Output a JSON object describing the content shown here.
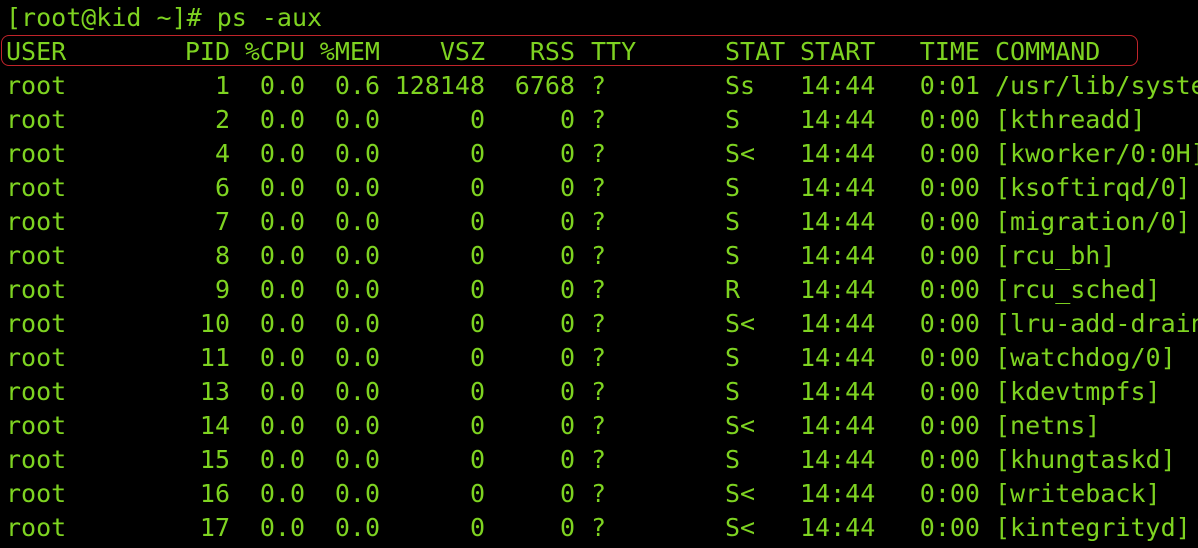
{
  "prompt": "[root@kid ~]# ps -aux",
  "header": {
    "user": "USER",
    "pid": "PID",
    "cpu": "%CPU",
    "mem": "%MEM",
    "vsz": "VSZ",
    "rss": "RSS",
    "tty": "TTY",
    "stat": "STAT",
    "start": "START",
    "time": "TIME",
    "command": "COMMAND"
  },
  "colors": {
    "text": "#7ed321",
    "background": "#000000",
    "highlight_border": "#c0242a"
  },
  "rows": [
    {
      "user": "root",
      "pid": "1",
      "cpu": "0.0",
      "mem": "0.6",
      "vsz": "128148",
      "rss": "6768",
      "tty": "?",
      "stat": "Ss",
      "start": "14:44",
      "time": "0:01",
      "command": "/usr/lib/syste"
    },
    {
      "user": "root",
      "pid": "2",
      "cpu": "0.0",
      "mem": "0.0",
      "vsz": "0",
      "rss": "0",
      "tty": "?",
      "stat": "S",
      "start": "14:44",
      "time": "0:00",
      "command": "[kthreadd]"
    },
    {
      "user": "root",
      "pid": "4",
      "cpu": "0.0",
      "mem": "0.0",
      "vsz": "0",
      "rss": "0",
      "tty": "?",
      "stat": "S<",
      "start": "14:44",
      "time": "0:00",
      "command": "[kworker/0:0H]"
    },
    {
      "user": "root",
      "pid": "6",
      "cpu": "0.0",
      "mem": "0.0",
      "vsz": "0",
      "rss": "0",
      "tty": "?",
      "stat": "S",
      "start": "14:44",
      "time": "0:00",
      "command": "[ksoftirqd/0]"
    },
    {
      "user": "root",
      "pid": "7",
      "cpu": "0.0",
      "mem": "0.0",
      "vsz": "0",
      "rss": "0",
      "tty": "?",
      "stat": "S",
      "start": "14:44",
      "time": "0:00",
      "command": "[migration/0]"
    },
    {
      "user": "root",
      "pid": "8",
      "cpu": "0.0",
      "mem": "0.0",
      "vsz": "0",
      "rss": "0",
      "tty": "?",
      "stat": "S",
      "start": "14:44",
      "time": "0:00",
      "command": "[rcu_bh]"
    },
    {
      "user": "root",
      "pid": "9",
      "cpu": "0.0",
      "mem": "0.0",
      "vsz": "0",
      "rss": "0",
      "tty": "?",
      "stat": "R",
      "start": "14:44",
      "time": "0:00",
      "command": "[rcu_sched]"
    },
    {
      "user": "root",
      "pid": "10",
      "cpu": "0.0",
      "mem": "0.0",
      "vsz": "0",
      "rss": "0",
      "tty": "?",
      "stat": "S<",
      "start": "14:44",
      "time": "0:00",
      "command": "[lru-add-drain"
    },
    {
      "user": "root",
      "pid": "11",
      "cpu": "0.0",
      "mem": "0.0",
      "vsz": "0",
      "rss": "0",
      "tty": "?",
      "stat": "S",
      "start": "14:44",
      "time": "0:00",
      "command": "[watchdog/0]"
    },
    {
      "user": "root",
      "pid": "13",
      "cpu": "0.0",
      "mem": "0.0",
      "vsz": "0",
      "rss": "0",
      "tty": "?",
      "stat": "S",
      "start": "14:44",
      "time": "0:00",
      "command": "[kdevtmpfs]"
    },
    {
      "user": "root",
      "pid": "14",
      "cpu": "0.0",
      "mem": "0.0",
      "vsz": "0",
      "rss": "0",
      "tty": "?",
      "stat": "S<",
      "start": "14:44",
      "time": "0:00",
      "command": "[netns]"
    },
    {
      "user": "root",
      "pid": "15",
      "cpu": "0.0",
      "mem": "0.0",
      "vsz": "0",
      "rss": "0",
      "tty": "?",
      "stat": "S",
      "start": "14:44",
      "time": "0:00",
      "command": "[khungtaskd]"
    },
    {
      "user": "root",
      "pid": "16",
      "cpu": "0.0",
      "mem": "0.0",
      "vsz": "0",
      "rss": "0",
      "tty": "?",
      "stat": "S<",
      "start": "14:44",
      "time": "0:00",
      "command": "[writeback]"
    },
    {
      "user": "root",
      "pid": "17",
      "cpu": "0.0",
      "mem": "0.0",
      "vsz": "0",
      "rss": "0",
      "tty": "?",
      "stat": "S<",
      "start": "14:44",
      "time": "0:00",
      "command": "[kintegrityd]"
    }
  ]
}
